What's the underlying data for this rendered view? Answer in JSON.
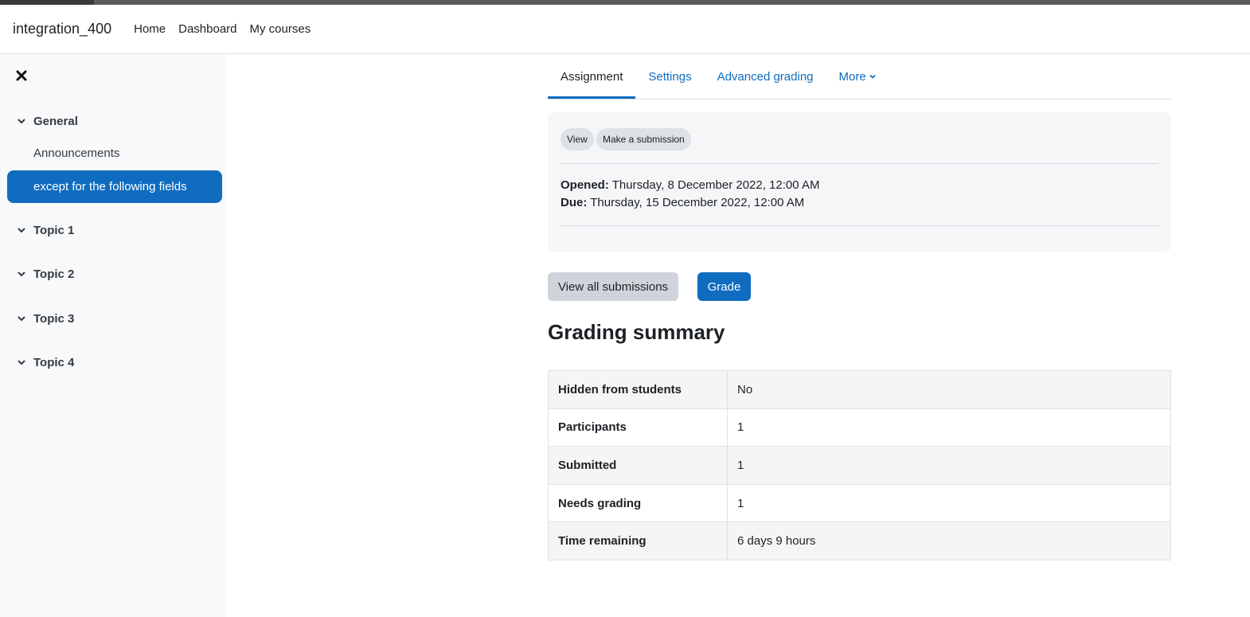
{
  "header": {
    "site_name": "integration_400",
    "nav": [
      "Home",
      "Dashboard",
      "My courses"
    ]
  },
  "drawer": {
    "close_icon": "close-icon",
    "sections": [
      {
        "title": "General"
      },
      {
        "title": "Topic 1"
      },
      {
        "title": "Topic 2"
      },
      {
        "title": "Topic 3"
      },
      {
        "title": "Topic 4"
      }
    ],
    "items": {
      "announcements": "Announcements",
      "active": "except for the following fields"
    }
  },
  "tabs": {
    "assignment": "Assignment",
    "settings": "Settings",
    "advanced_grading": "Advanced grading",
    "more": "More"
  },
  "activity": {
    "view": "View",
    "make_submission": "Make a submission",
    "opened_label": "Opened:",
    "opened_value": " Thursday, 8 December 2022, 12:00 AM",
    "due_label": "Due:",
    "due_value": " Thursday, 15 December 2022, 12:00 AM"
  },
  "actions": {
    "view_all": "View all submissions",
    "grade": "Grade"
  },
  "summary": {
    "title": "Grading summary",
    "rows": [
      {
        "label": "Hidden from students",
        "value": "No"
      },
      {
        "label": "Participants",
        "value": "1"
      },
      {
        "label": "Submitted",
        "value": "1"
      },
      {
        "label": "Needs grading",
        "value": "1"
      },
      {
        "label": "Time remaining",
        "value": "6 days 9 hours"
      }
    ]
  },
  "colors": {
    "primary": "#0f6cbf",
    "drawer_bg": "#f8f9fa"
  }
}
